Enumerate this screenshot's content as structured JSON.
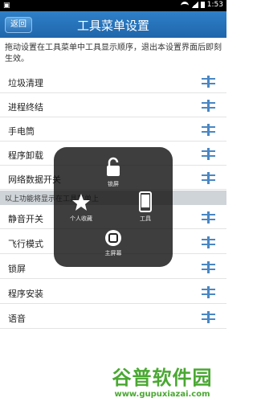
{
  "statusbar": {
    "time": "1:53"
  },
  "header": {
    "back_label": "返回",
    "title": "工具菜单设置"
  },
  "intro_text": "拖动设置在工具菜单中工具显示顺序，退出本设置界面后即刻生效。",
  "list": {
    "top": [
      {
        "label": "垃圾清理"
      },
      {
        "label": "进程终结"
      },
      {
        "label": "手电筒"
      },
      {
        "label": "程序卸载"
      },
      {
        "label": "网络数据开关"
      }
    ],
    "divider_text": "以上功能将显示在工具菜单上",
    "bottom": [
      {
        "label": "静音开关"
      },
      {
        "label": "飞行模式"
      },
      {
        "label": "锁屏"
      },
      {
        "label": "程序安装"
      },
      {
        "label": "语音"
      }
    ]
  },
  "overlay": {
    "lock_label": "锁屏",
    "favorites_label": "个人收藏",
    "tools_label": "工具",
    "home_label": "主屏幕"
  },
  "watermark": {
    "main": "谷普软件园",
    "url": "www.gupuxiazai.com"
  }
}
